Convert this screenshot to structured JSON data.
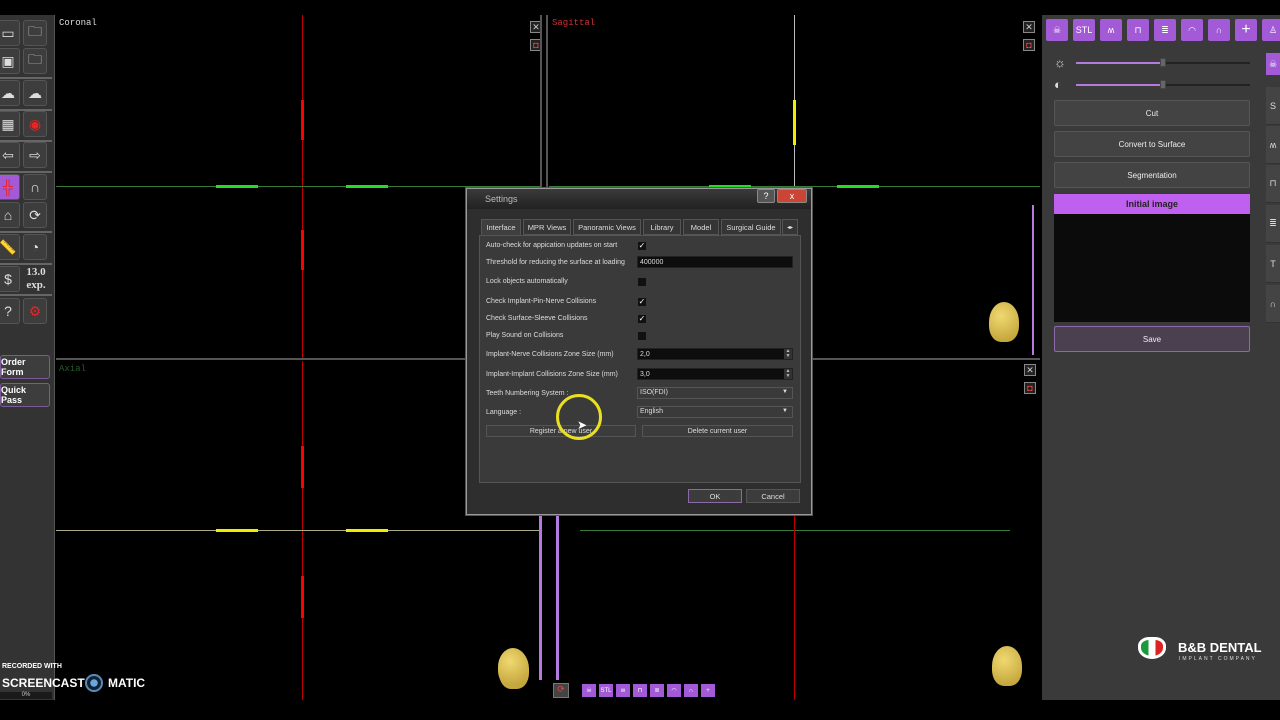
{
  "left_toolbar": {
    "exposure_value": "13.0",
    "exposure_unit": "exp.",
    "order_form": "Order Form",
    "quick_pass": "Quick Pass",
    "icons": [
      "new-file-icon",
      "open-folder-icon",
      "save-icon",
      "open-recent-icon",
      "cloud-download-icon",
      "cloud-upload-icon",
      "calendar-edit-icon",
      "record-icon",
      "undo-arrow-icon",
      "redo-arrow-icon",
      "layout-grid-icon",
      "panoramic-curve-icon",
      "home-icon",
      "rotate-icon",
      "ruler-icon",
      "angle-icon",
      "dollar-icon",
      "help-icon",
      "settings-gear-icon"
    ]
  },
  "viewports": {
    "coronal": "Coronal",
    "sagittal": "Sagittal",
    "axial": "Axial"
  },
  "right_panel": {
    "top_icons": [
      "skull-icon",
      "STL",
      "panoramic-teeth-icon",
      "tooth-icon",
      "implant-icon",
      "protractor-icon",
      "guide-icon",
      "plus-icon",
      "user-list-icon"
    ],
    "stl_label": "STL",
    "buttons": {
      "cut": "Cut",
      "convert": "Convert to Surface",
      "segmentation": "Segmentation",
      "save": "Save"
    },
    "list_header": "Initial image",
    "brightness": 0.48,
    "contrast": 0.48,
    "side_tabs": [
      "skull-icon",
      "stl-icon",
      "panoramic-icon",
      "tooth-icon",
      "implant-icon",
      "abutment-icon",
      "guide-icon"
    ]
  },
  "dialog": {
    "title": "Settings",
    "help": "?",
    "close": "x",
    "tabs": [
      "Interface",
      "MPR Views",
      "Panoramic Views",
      "Library",
      "Model",
      "Surgical Guide"
    ],
    "rows": {
      "auto_check": {
        "label": "Auto-check for appication updates on start",
        "checked": true
      },
      "threshold": {
        "label": "Threshold for reducing the surface at loading",
        "value": "400000"
      },
      "lock": {
        "label": "Lock objects automatically",
        "checked": false
      },
      "pin_nerve": {
        "label": "Check Implant-Pin-Nerve Collisions",
        "checked": true
      },
      "sleeve": {
        "label": "Check Surface-Sleeve Collisions",
        "checked": true
      },
      "sound": {
        "label": "Play Sound on Collisions",
        "checked": false
      },
      "nerve_zone": {
        "label": "Implant-Nerve Collisions Zone Size (mm)",
        "value": "2,0"
      },
      "implant_zone": {
        "label": "Implant-Implant Collisions Zone Size (mm)",
        "value": "3,0"
      },
      "teeth": {
        "label": "Teeth Numbering System :",
        "value": "ISO(FDI)"
      },
      "language": {
        "label": "Language :",
        "value": "English"
      }
    },
    "register": "Register a new user",
    "delete": "Delete current user",
    "ok": "OK",
    "cancel": "Cancel",
    "check_mark": "✓"
  },
  "watermark": {
    "line1": "RECORDED WITH",
    "brand_a": "SCREENCAST",
    "brand_b": "MATIC",
    "progress": "0%"
  },
  "logo": {
    "name": "B&B DENTAL",
    "tagline": "IMPLANT COMPANY"
  },
  "colors": {
    "accent": "#a35ad6",
    "highlight": "#c060f0"
  }
}
